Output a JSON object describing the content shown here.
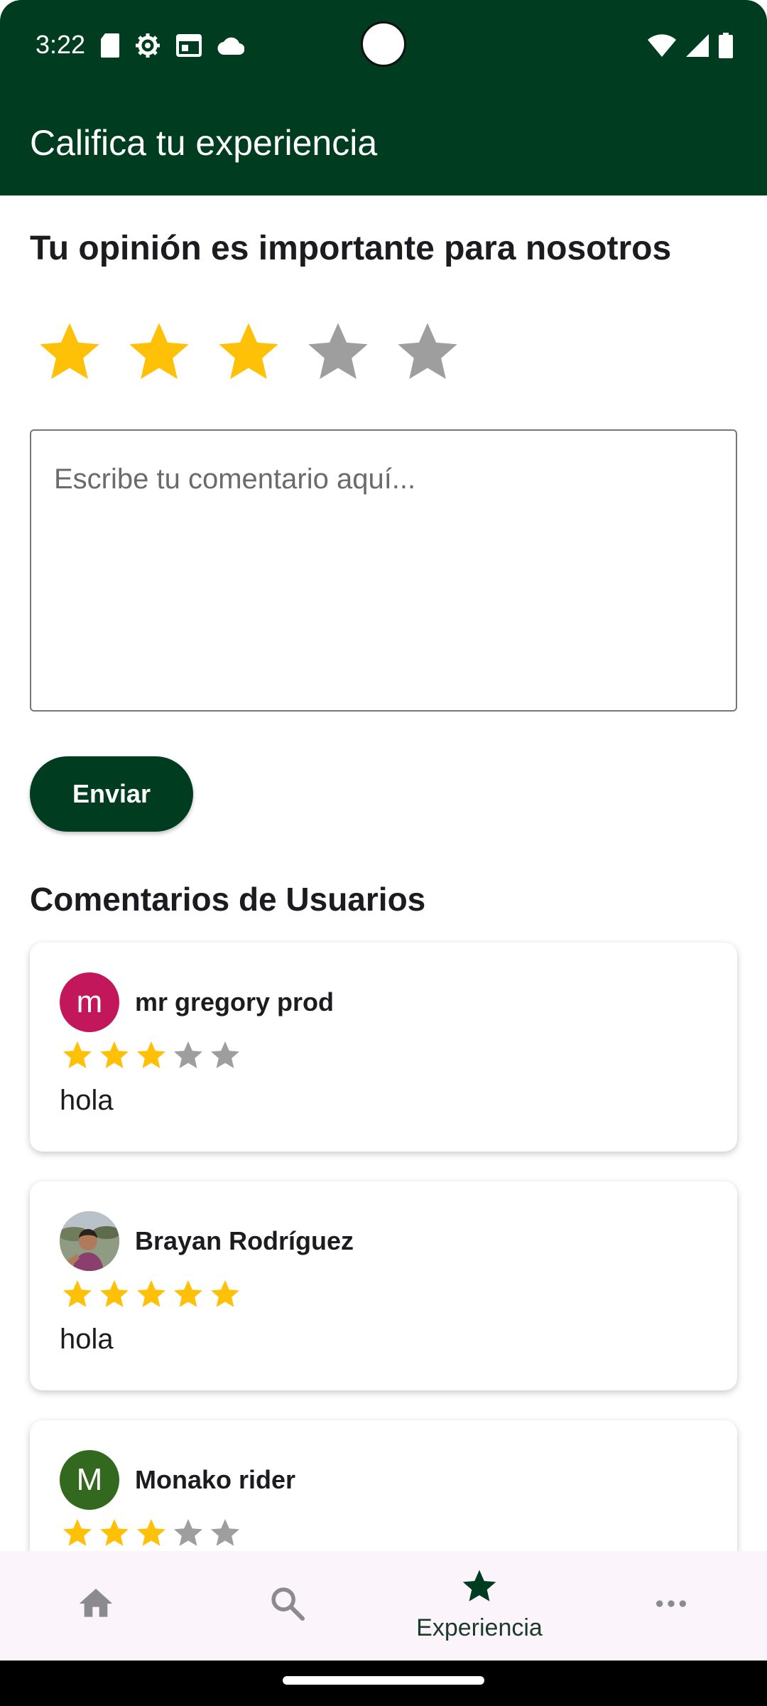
{
  "status_bar": {
    "time": "3:22",
    "left_icons": [
      "sd-card-icon",
      "settings-gear-icon",
      "calendar-icon",
      "cloud-icon"
    ],
    "right_icons": [
      "wifi-icon",
      "signal-icon",
      "battery-icon"
    ]
  },
  "app_bar": {
    "title": "Califica tu experiencia",
    "color": "#003d20"
  },
  "rating_form": {
    "heading": "Tu opinión es importante para nosotros",
    "rating": 3,
    "max_rating": 5,
    "comment_placeholder": "Escribe tu comentario aquí...",
    "comment_value": "",
    "submit_label": "Enviar"
  },
  "comments_section": {
    "title": "Comentarios de Usuarios",
    "comments": [
      {
        "avatar_letter": "m",
        "avatar_color": "#c2185b",
        "name": "mr gregory prod",
        "rating": 3,
        "text": "hola"
      },
      {
        "avatar_letter": "",
        "avatar_type": "photo",
        "name": "Brayan Rodríguez",
        "rating": 5,
        "text": "hola"
      },
      {
        "avatar_letter": "M",
        "avatar_color": "#33691e",
        "name": "Monako rider",
        "rating": 3,
        "text": ""
      }
    ]
  },
  "bottom_nav": {
    "items": [
      {
        "icon": "home-icon",
        "label": ""
      },
      {
        "icon": "search-icon",
        "label": ""
      },
      {
        "icon": "star-icon",
        "label": "Experiencia",
        "active": true
      },
      {
        "icon": "more-horizontal-icon",
        "label": ""
      }
    ]
  },
  "colors": {
    "star_filled": "#ffc107",
    "star_empty": "#9e9e9e",
    "primary": "#003d20"
  }
}
